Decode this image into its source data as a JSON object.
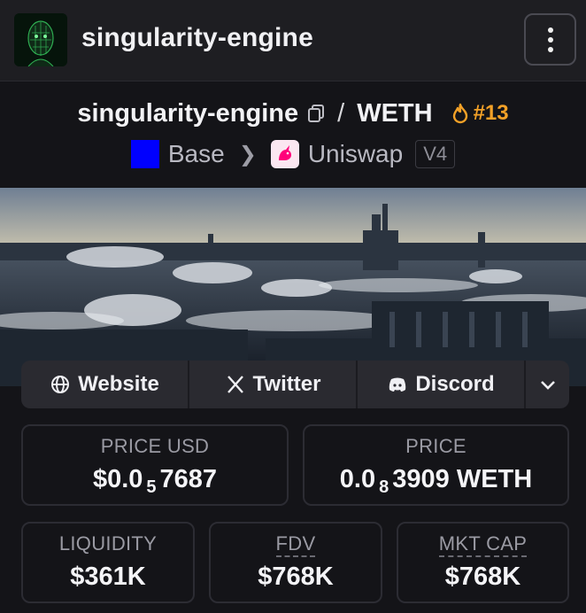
{
  "header": {
    "title": "singularity-engine",
    "menu_icon": "more-vertical-icon"
  },
  "pair": {
    "base_token": "singularity-engine",
    "separator": "/",
    "quote_token": "WETH",
    "rank": "#13",
    "rank_icon": "flame-icon",
    "rank_color": "#f3a127"
  },
  "chain": {
    "network": "Base",
    "network_color": "#0000ff",
    "dex": "Uniswap",
    "version": "V4"
  },
  "links": {
    "website": "Website",
    "twitter": "Twitter",
    "discord": "Discord"
  },
  "stats": {
    "price_usd": {
      "label": "PRICE USD",
      "prefix": "$0.0",
      "zeros": "5",
      "digits": "7687"
    },
    "price": {
      "label": "PRICE",
      "prefix": "0.0",
      "zeros": "8",
      "digits": "3909 WETH"
    },
    "liquidity": {
      "label": "LIQUIDITY",
      "value": "$361K"
    },
    "fdv": {
      "label": "FDV",
      "value": "$768K"
    },
    "mkt_cap": {
      "label": "MKT CAP",
      "value": "$768K"
    }
  }
}
